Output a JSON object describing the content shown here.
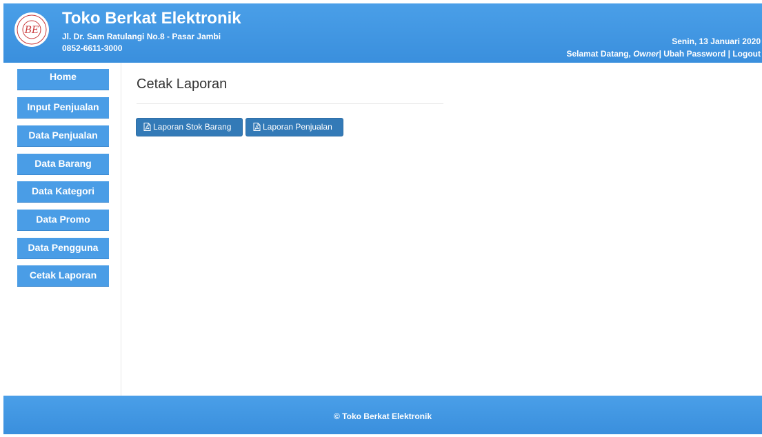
{
  "header": {
    "logo_text": "BE",
    "shop_name": "Toko Berkat Elektronik",
    "address": "Jl. Dr. Sam Ratulangi No.8 - Pasar Jambi",
    "phone": "0852-6611-3000",
    "date": "Senin, 13 Januari 2020",
    "welcome_prefix": "Selamat Datang,",
    "user_role": "Owner",
    "change_password": "Ubah Password",
    "logout": "Logout",
    "separator": "|"
  },
  "sidebar": {
    "items": [
      {
        "label": "Home"
      },
      {
        "label": "Input Penjualan"
      },
      {
        "label": "Data Penjualan"
      },
      {
        "label": "Data Barang"
      },
      {
        "label": "Data Kategori"
      },
      {
        "label": "Data Promo"
      },
      {
        "label": "Data Pengguna"
      },
      {
        "label": "Cetak Laporan"
      }
    ]
  },
  "main": {
    "title": "Cetak Laporan",
    "buttons": {
      "stock_report": "Laporan Stok Barang",
      "sales_report": "Laporan Penjualan"
    }
  },
  "footer": {
    "text": "© Toko Berkat Elektronik"
  },
  "icons": {
    "pdf": "pdf-file-icon"
  },
  "colors": {
    "header_blue": "#3d94e0",
    "nav_blue": "#4a9de6",
    "button_blue": "#337ab7"
  }
}
